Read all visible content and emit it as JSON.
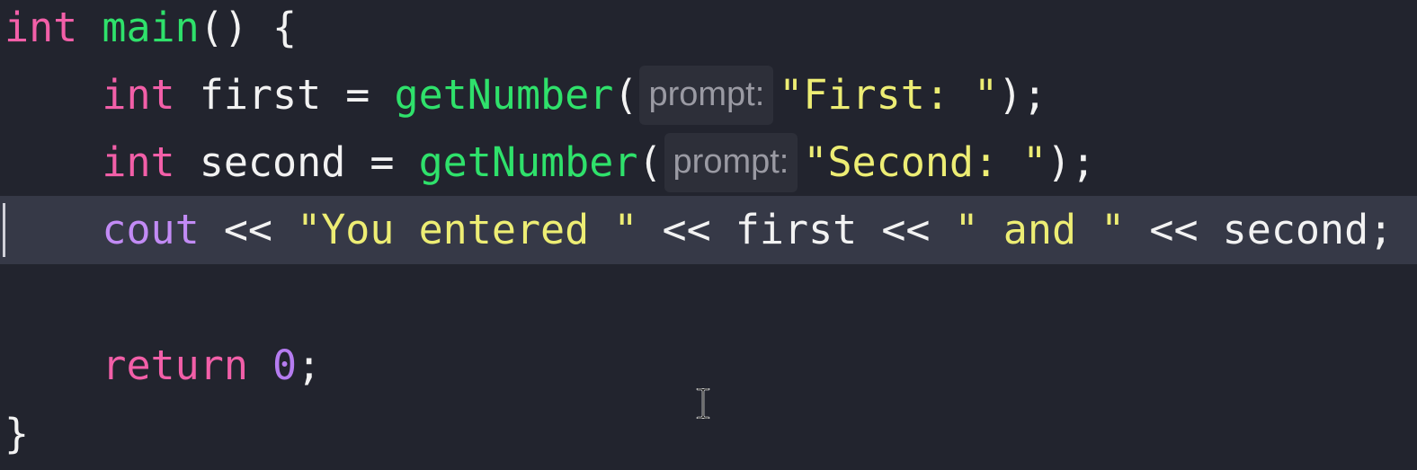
{
  "editor": {
    "lines": [
      {
        "tokens": [
          {
            "text": "int",
            "cls": "kw"
          },
          {
            "text": " ",
            "cls": "plain"
          },
          {
            "text": "main",
            "cls": "fn"
          },
          {
            "text": "() {",
            "cls": "plain"
          }
        ]
      },
      {
        "tokens": [
          {
            "text": "    ",
            "cls": "plain"
          },
          {
            "text": "int",
            "cls": "kw"
          },
          {
            "text": " first = ",
            "cls": "plain"
          },
          {
            "text": "getNumber",
            "cls": "fn"
          },
          {
            "text": "(",
            "cls": "plain"
          },
          {
            "hint": "prompt:"
          },
          {
            "text": "\"First: \"",
            "cls": "str"
          },
          {
            "text": ");",
            "cls": "plain"
          }
        ]
      },
      {
        "tokens": [
          {
            "text": "    ",
            "cls": "plain"
          },
          {
            "text": "int",
            "cls": "kw"
          },
          {
            "text": " second = ",
            "cls": "plain"
          },
          {
            "text": "getNumber",
            "cls": "fn"
          },
          {
            "text": "(",
            "cls": "plain"
          },
          {
            "hint": "prompt:"
          },
          {
            "text": "\"Second: \"",
            "cls": "str"
          },
          {
            "text": ");",
            "cls": "plain"
          }
        ]
      },
      {
        "current": true,
        "tokens": [
          {
            "text": "    ",
            "cls": "plain"
          },
          {
            "text": "cout",
            "cls": "kw2"
          },
          {
            "text": " << ",
            "cls": "plain"
          },
          {
            "text": "\"You entered \"",
            "cls": "str"
          },
          {
            "text": " << first << ",
            "cls": "plain"
          },
          {
            "text": "\" and \"",
            "cls": "str"
          },
          {
            "text": " << second;",
            "cls": "plain"
          }
        ]
      },
      {
        "tokens": []
      },
      {
        "tokens": [
          {
            "text": "    ",
            "cls": "plain"
          },
          {
            "text": "return",
            "cls": "kw"
          },
          {
            "text": " ",
            "cls": "plain"
          },
          {
            "text": "0",
            "cls": "num"
          },
          {
            "text": ";",
            "cls": "plain"
          }
        ]
      },
      {
        "tokens": [
          {
            "text": "}",
            "cls": "plain"
          }
        ]
      }
    ]
  },
  "colors": {
    "background": "#22242e",
    "current_line": "#363947",
    "keyword": "#f25fa8",
    "keyword_alt": "#c28bf5",
    "function": "#2fe16b",
    "string": "#eded74",
    "number": "#b57cf0",
    "hint_text": "#9a9aa3",
    "hint_background": "#2d2f39"
  },
  "cursor": {
    "icon": "text-cursor-icon"
  }
}
